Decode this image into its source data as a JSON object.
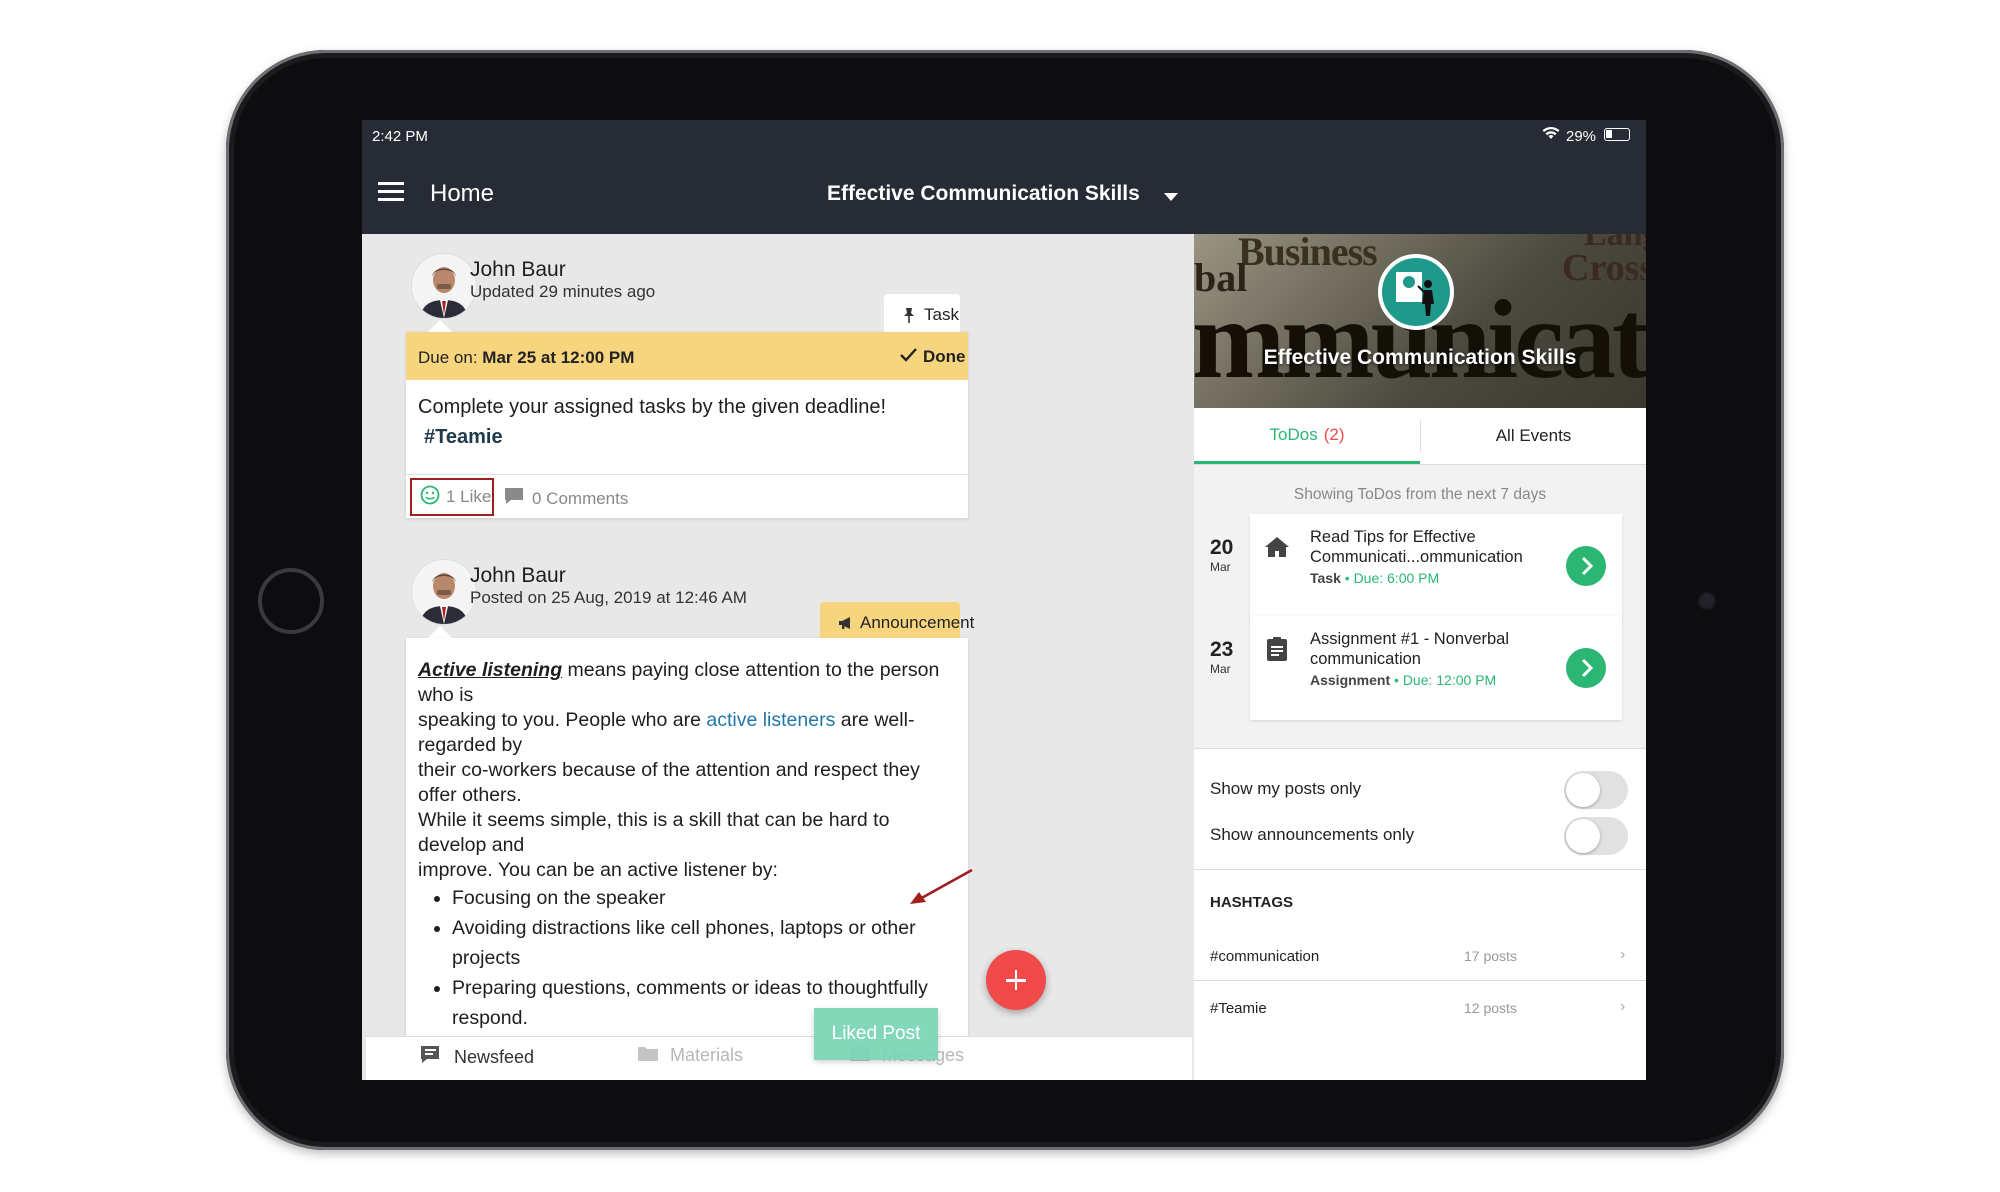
{
  "status": {
    "time": "2:42 PM",
    "battery": "29%"
  },
  "nav": {
    "title": "Home",
    "course": "Effective Communication Skills"
  },
  "posts": [
    {
      "author": "John Baur",
      "meta": "Updated 29 minutes ago",
      "type_label": "Task",
      "due_prefix": "Due on:",
      "due_value": "Mar 25 at 12:00 PM",
      "status_label": "Done",
      "text": "Complete your assigned tasks by the given deadline!",
      "hashtag": "#Teamie",
      "likes": "1 Like",
      "comments": "0 Comments"
    },
    {
      "author": "John Baur",
      "meta": "Posted on 25 Aug, 2019 at 12:46 AM",
      "type_label": "Announcement",
      "lead_link": "Active listening",
      "para_1": " means paying close attention to the person who is",
      "para_2_a": "speaking to you. People who are ",
      "para_2_link": "active listeners",
      "para_2_b": " are well-regarded by",
      "para_3": "their co-workers because of the attention and respect they offer others.",
      "para_4": "While it seems simple, this is a skill that can be hard to develop and",
      "para_5": "improve. You can be an active listener by:",
      "bullets": [
        "Focusing on the speaker",
        "Avoiding distractions like cell phones, laptops or other projects",
        "Preparing questions, comments or ideas to thoughtfully respond."
      ]
    }
  ],
  "toast": "Liked Post",
  "bottom_nav": {
    "newsfeed": "Newsfeed",
    "materials": "Materials",
    "messages": "Messages"
  },
  "course_banner": {
    "title": "Effective Communication Skills",
    "bg_words": [
      "Business",
      "bal",
      "Cross",
      "Langu",
      "mmunicat"
    ]
  },
  "tabs": {
    "todos": "ToDos",
    "todos_count": "(2)",
    "events": "All Events"
  },
  "todos_caption": "Showing ToDos from the next 7 days",
  "todos": [
    {
      "day": "20",
      "month": "Mar",
      "title_1": "Read Tips for Effective",
      "title_2": "Communicati...ommunication",
      "kind": "Task",
      "sep": "•",
      "due": "Due: 6:00 PM"
    },
    {
      "day": "23",
      "month": "Mar",
      "title_1": "Assignment #1 - Nonverbal",
      "title_2": "communication",
      "kind": "Assignment",
      "sep": "•",
      "due": "Due: 12:00 PM"
    }
  ],
  "filters": {
    "my_posts": "Show my posts only",
    "announcements": "Show announcements only"
  },
  "hashtags": {
    "heading": "HASHTAGS",
    "items": [
      {
        "tag": "#communication",
        "count": "17 posts"
      },
      {
        "tag": "#Teamie",
        "count": "12 posts"
      }
    ]
  },
  "colors": {
    "accent": "#2bb673",
    "due_bar": "#f7d57e",
    "nav_bg": "#272b35",
    "fab": "#f04a4a",
    "toast": "#7dd6b7",
    "highlight": "#a0201e"
  }
}
